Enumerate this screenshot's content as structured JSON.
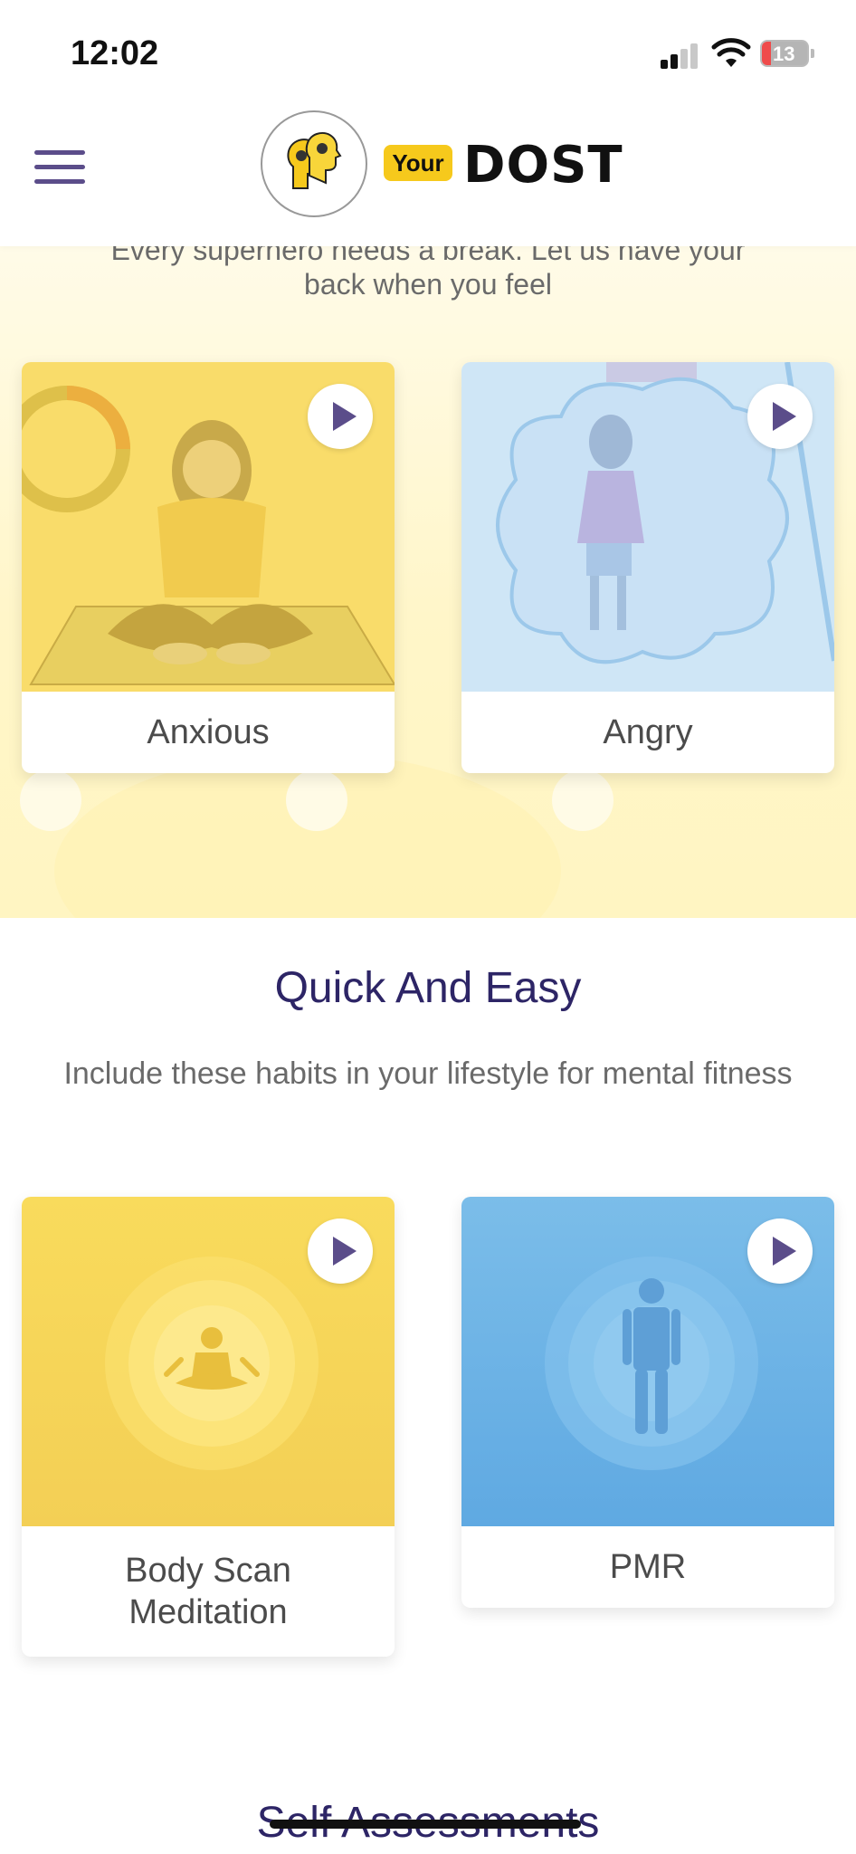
{
  "status_bar": {
    "time": "12:02",
    "battery": "13"
  },
  "header": {
    "logo_your": "Your",
    "logo_dost": "DOST"
  },
  "mood": {
    "subtitle_line1": "Every superhero needs a break. Let us have your",
    "subtitle_line2": "back when you feel",
    "cards": [
      {
        "label": "Anxious"
      },
      {
        "label": "Angry"
      }
    ]
  },
  "quick": {
    "title": "Quick And Easy",
    "subtitle": "Include these habits in your lifestyle for mental fitness",
    "cards": [
      {
        "label": "Body Scan Meditation"
      },
      {
        "label": "PMR"
      }
    ]
  },
  "self_assessments": {
    "title": "Self Assessments"
  },
  "colors": {
    "accent": "#5b4d8a",
    "title": "#2d2566",
    "yellow": "#fadf72",
    "blue": "#6fb4e8"
  }
}
